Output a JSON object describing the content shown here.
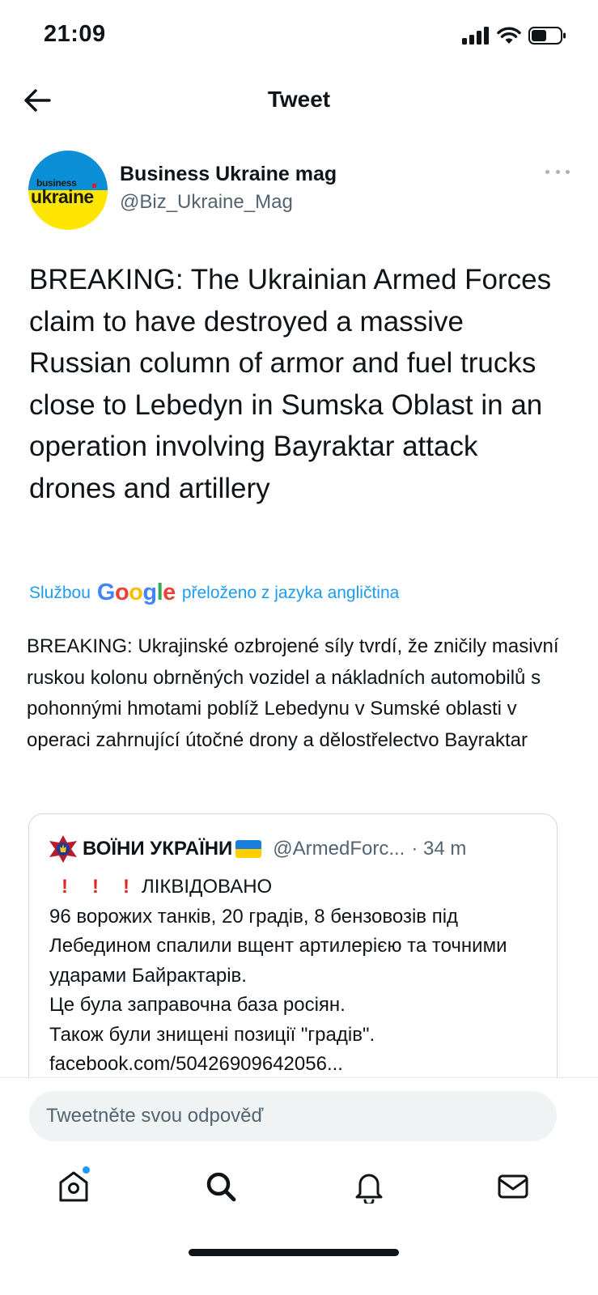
{
  "status_bar": {
    "time": "21:09"
  },
  "nav": {
    "title": "Tweet"
  },
  "author": {
    "name": "Business Ukraine mag",
    "handle": "@Biz_Ukraine_Mag",
    "avatar_text_small": "business",
    "avatar_text_big": "ukraine"
  },
  "tweet": {
    "text": "BREAKING: The Ukrainian Armed Forces claim to have destroyed a massive Russian column of armor and fuel trucks close to Lebedyn in Sumska Oblast in an operation involving Bayraktar attack drones and artillery"
  },
  "translation": {
    "prefix": "Službou",
    "google": "Google",
    "suffix": "přeloženo z jazyka angličtina",
    "text": "BREAKING: Ukrajinské ozbrojené síly tvrdí, že zničily masivní ruskou kolonu obrněných vozidel a nákladních automobilů s pohonnými hmotami poblíž Lebedynu v Sumské oblasti v operaci zahrnující útočné drony a dělostřelectvo Bayraktar"
  },
  "quote": {
    "name": "ВОЇНИ УКРАЇНИ",
    "handle": "@ArmedForc...",
    "time": "· 34 m",
    "headline": "ЛІКВІДОВАНО",
    "lines": [
      "96 ворожих танків, 20 градів, 8 бензовозів під Лебедином спалили вщент артилерією та точними ударами Байрактарів.",
      "Це була заправочна база росіян.",
      "Також були знищені позиції \"градів\".",
      "facebook.com/50426909642056..."
    ]
  },
  "reply": {
    "placeholder": "Tweetněte svou odpověď"
  },
  "colors": {
    "accent": "#1d9bf0",
    "text": "#0f1419",
    "secondary": "#536471"
  }
}
